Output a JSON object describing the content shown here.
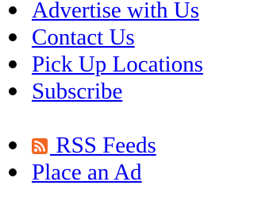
{
  "links_primary": [
    {
      "label": "Advertise with Us"
    },
    {
      "label": "Contact Us"
    },
    {
      "label": "Pick Up Locations"
    },
    {
      "label": "Subscribe"
    }
  ],
  "links_secondary": [
    {
      "label": " RSS Feeds",
      "icon": "rss-icon"
    },
    {
      "label": "Place an Ad"
    }
  ],
  "colors": {
    "link": "#0000ee",
    "rss_orange": "#f26522"
  }
}
